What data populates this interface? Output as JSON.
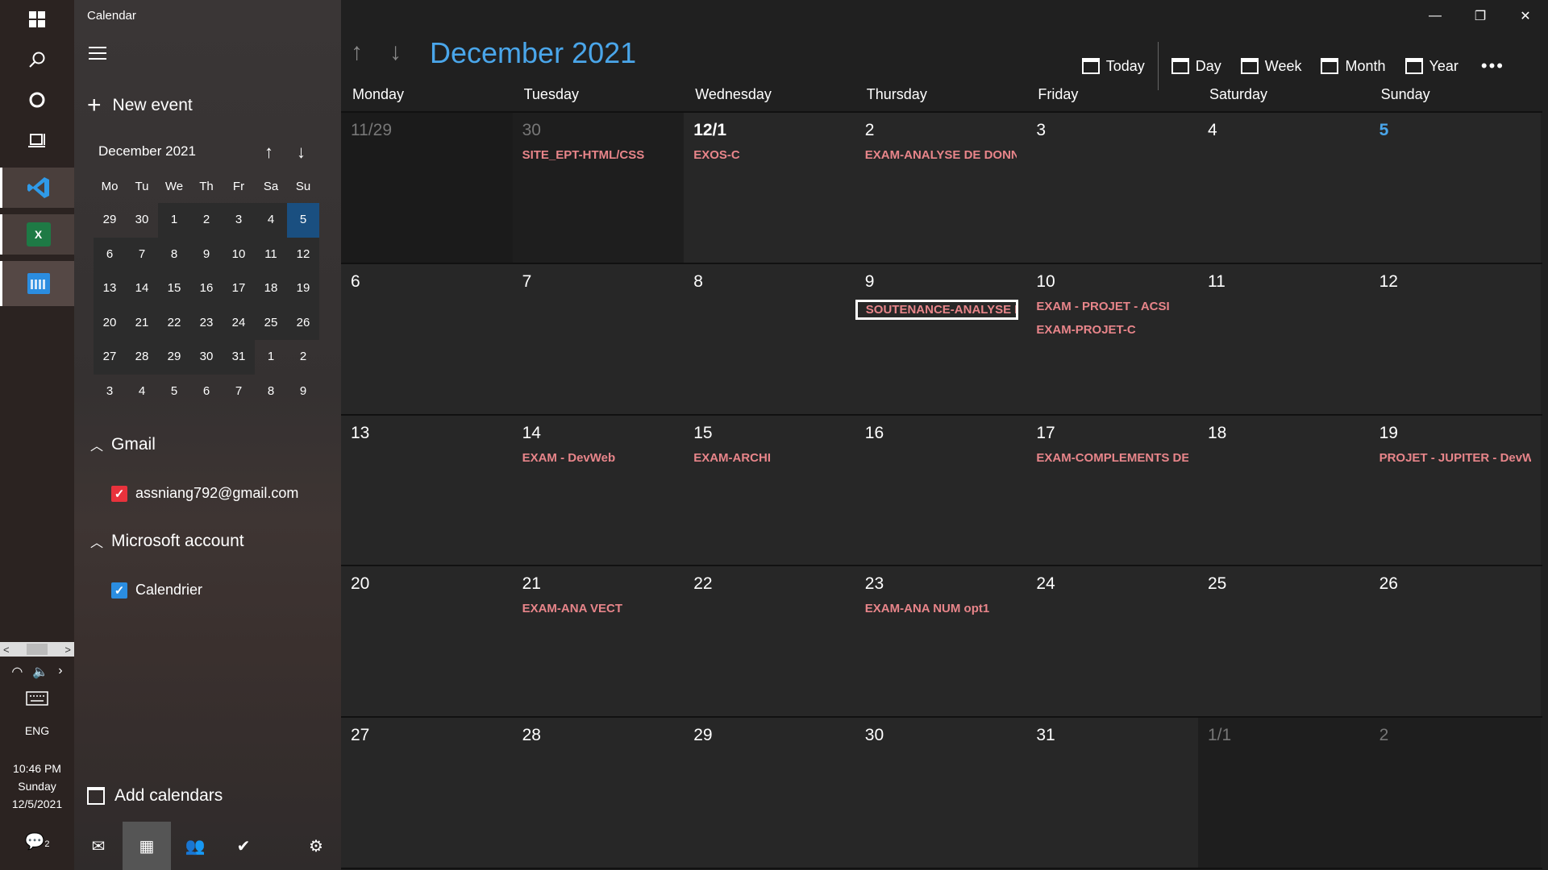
{
  "app_title": "Calendar",
  "taskbar": {
    "icons": [
      "windows-start-icon",
      "search-icon",
      "cortana-icon",
      "task-view-icon",
      "vscode-icon",
      "excel-icon",
      "calendar-app-icon"
    ],
    "language": "ENG",
    "time": "10:46 PM",
    "weekday": "Sunday",
    "date": "12/5/2021",
    "notification_count": "2"
  },
  "sidebar": {
    "new_event_label": "New event",
    "mini_calendar": {
      "month_label": "December 2021",
      "weekdays": [
        "Mo",
        "Tu",
        "We",
        "Th",
        "Fr",
        "Sa",
        "Su"
      ],
      "weeks": [
        [
          "29",
          "30",
          "1",
          "2",
          "3",
          "4",
          "5"
        ],
        [
          "6",
          "7",
          "8",
          "9",
          "10",
          "11",
          "12"
        ],
        [
          "13",
          "14",
          "15",
          "16",
          "17",
          "18",
          "19"
        ],
        [
          "20",
          "21",
          "22",
          "23",
          "24",
          "25",
          "26"
        ],
        [
          "27",
          "28",
          "29",
          "30",
          "31",
          "1",
          "2"
        ],
        [
          "3",
          "4",
          "5",
          "6",
          "7",
          "8",
          "9"
        ]
      ]
    },
    "accounts": [
      {
        "name": "Gmail",
        "calendars": [
          {
            "label": "assniang792@gmail.com",
            "checked": true,
            "color": "#e8323c"
          }
        ]
      },
      {
        "name": "Microsoft account",
        "calendars": [
          {
            "label": "Calendrier",
            "checked": true,
            "color": "#2b8de0"
          }
        ]
      }
    ],
    "add_calendars_label": "Add calendars"
  },
  "header": {
    "month_title": "December 2021",
    "views": [
      "Today",
      "Day",
      "Week",
      "Month",
      "Year"
    ]
  },
  "weekdays": [
    "Monday",
    "Tuesday",
    "Wednesday",
    "Thursday",
    "Friday",
    "Saturday",
    "Sunday"
  ],
  "weeks": [
    [
      {
        "day": "11/29",
        "out": true,
        "events": []
      },
      {
        "day": "30",
        "out": true,
        "events": [
          "SITE_EPT-HTML/CSS"
        ]
      },
      {
        "day": "12/1",
        "first": true,
        "events": [
          "EXOS-C"
        ]
      },
      {
        "day": "2",
        "events": [
          "EXAM-ANALYSE DE DONNEES"
        ]
      },
      {
        "day": "3",
        "events": []
      },
      {
        "day": "4",
        "events": []
      },
      {
        "day": "5",
        "today": true,
        "events": []
      }
    ],
    [
      {
        "day": "6",
        "events": []
      },
      {
        "day": "7",
        "events": []
      },
      {
        "day": "8",
        "events": []
      },
      {
        "day": "9",
        "events": [
          "SOUTENANCE-ANALYSE DE DONNEES"
        ],
        "selected": 0
      },
      {
        "day": "10",
        "events": [
          "EXAM - PROJET - ACSI",
          "EXAM-PROJET-C"
        ]
      },
      {
        "day": "11",
        "events": []
      },
      {
        "day": "12",
        "events": []
      }
    ],
    [
      {
        "day": "13",
        "events": []
      },
      {
        "day": "14",
        "events": [
          "EXAM - DevWeb"
        ]
      },
      {
        "day": "15",
        "events": [
          "EXAM-ARCHI"
        ]
      },
      {
        "day": "16",
        "events": []
      },
      {
        "day": "17",
        "events": [
          "EXAM-COMPLEMENTS DE"
        ]
      },
      {
        "day": "18",
        "events": []
      },
      {
        "day": "19",
        "events": [
          "PROJET - JUPITER - DevWeb"
        ]
      }
    ],
    [
      {
        "day": "20",
        "events": []
      },
      {
        "day": "21",
        "events": [
          "EXAM-ANA VECT"
        ]
      },
      {
        "day": "22",
        "events": []
      },
      {
        "day": "23",
        "events": [
          "EXAM-ANA NUM opt1"
        ]
      },
      {
        "day": "24",
        "events": []
      },
      {
        "day": "25",
        "events": []
      },
      {
        "day": "26",
        "events": []
      }
    ],
    [
      {
        "day": "27",
        "events": []
      },
      {
        "day": "28",
        "events": []
      },
      {
        "day": "29",
        "events": []
      },
      {
        "day": "30",
        "events": []
      },
      {
        "day": "31",
        "events": []
      },
      {
        "day": "1/1",
        "out": true,
        "events": []
      },
      {
        "day": "2",
        "out": true,
        "events": []
      }
    ]
  ],
  "colors": {
    "accent": "#4aa6ea",
    "event_text": "#e8858a",
    "today_highlight": "#1a4f80"
  }
}
